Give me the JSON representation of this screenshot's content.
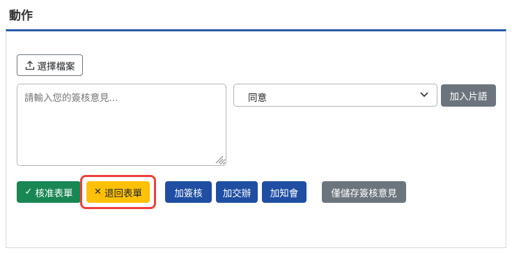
{
  "header": {
    "title": "動作"
  },
  "upload": {
    "label": "選擇檔案",
    "icon": "upload-icon"
  },
  "comment": {
    "placeholder": "請輸入您的簽核意見..."
  },
  "phrase_select": {
    "selected": "同意"
  },
  "phrase_button": {
    "label": "加入片語"
  },
  "actions": {
    "approve": {
      "label": "核准表單",
      "icon": "check-icon"
    },
    "return": {
      "label": "退回表單",
      "icon": "close-icon"
    },
    "add_sign": {
      "label": "加簽核"
    },
    "add_co": {
      "label": "加交辦"
    },
    "add_notify": {
      "label": "加知會"
    },
    "save_only": {
      "label": "僅儲存簽核意見"
    }
  },
  "colors": {
    "accent": "#2b5aa6",
    "success": "#198754",
    "warning": "#ffc107",
    "primary": "#1f4ea3",
    "secondary": "#6c757d",
    "highlight": "#ef3f3f"
  }
}
